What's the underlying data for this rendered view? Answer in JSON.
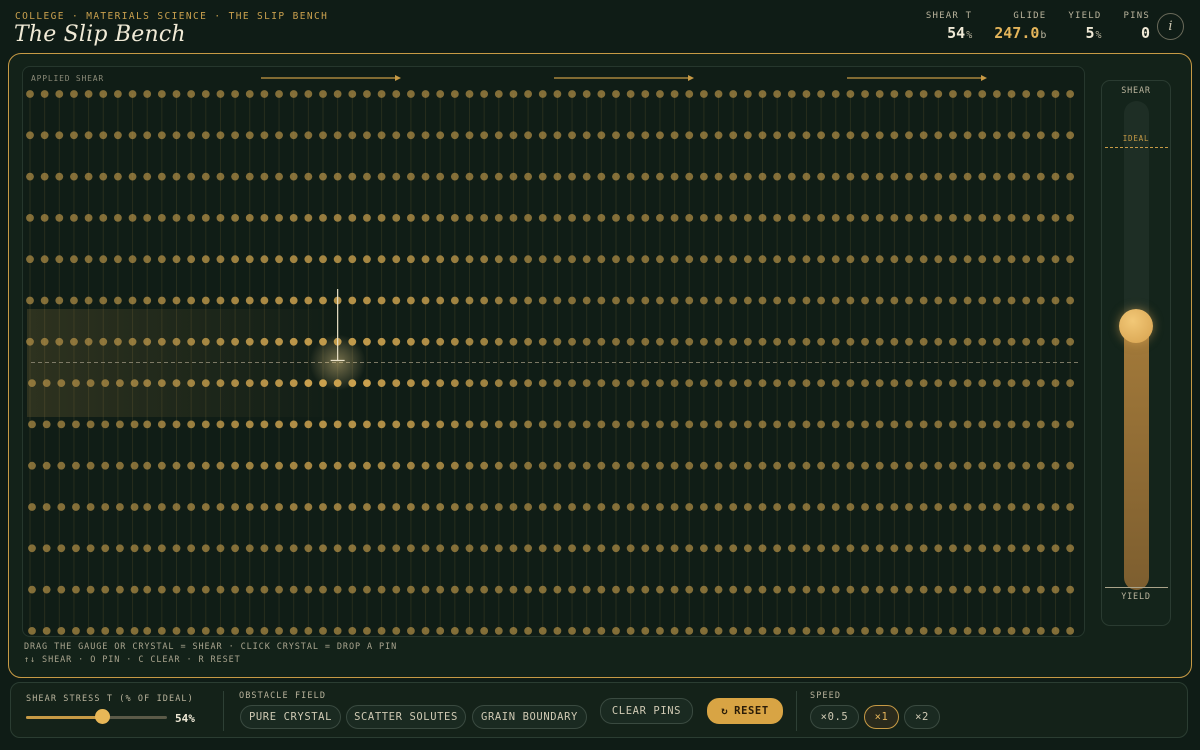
{
  "header": {
    "kicker": "COLLEGE · MATERIALS SCIENCE · THE SLIP BENCH",
    "title": "The Slip Bench",
    "stats": [
      {
        "label": "SHEAR T",
        "value": "54",
        "unit": "%"
      },
      {
        "label": "GLIDE",
        "value": "247.0",
        "unit": "b"
      },
      {
        "label": "YIELD",
        "value": "5",
        "unit": "%"
      },
      {
        "label": "PINS",
        "value": "0",
        "unit": ""
      }
    ],
    "info_icon": "info-icon"
  },
  "crystal": {
    "label": "APPLIED SHEAR",
    "hint_line1": "DRAG THE GAUGE OR CRYSTAL = SHEAR · CLICK CRYSTAL = DROP A PIN",
    "hint_line2": "↑↓ SHEAR · O PIN · C CLEAR · R RESET",
    "lattice": {
      "rows": 14,
      "columns": 72,
      "dislocation_row_above": 6,
      "dislocation_column": 21
    }
  },
  "gauge": {
    "label_top": "SHEAR",
    "label_ideal": "IDEAL",
    "label_yield": "YIELD",
    "level_fraction": 0.54
  },
  "controls": {
    "shear_label": "SHEAR STRESS T (% OF IDEAL)",
    "shear_value": "54%",
    "shear_fraction": 0.54,
    "obstacle_label": "OBSTACLE FIELD",
    "obstacle_options": [
      "PURE CRYSTAL",
      "SCATTER SOLUTES",
      "GRAIN BOUNDARY"
    ],
    "clear_label": "CLEAR PINS",
    "reset_label": "RESET",
    "reset_icon": "↻",
    "speed_label": "SPEED",
    "speed_options": [
      "×0.5",
      "×1",
      "×2"
    ],
    "speed_selected": "×1"
  },
  "colors": {
    "accent": "#c79a45",
    "atom": "#c9a04e",
    "background": "#0f1c16"
  }
}
